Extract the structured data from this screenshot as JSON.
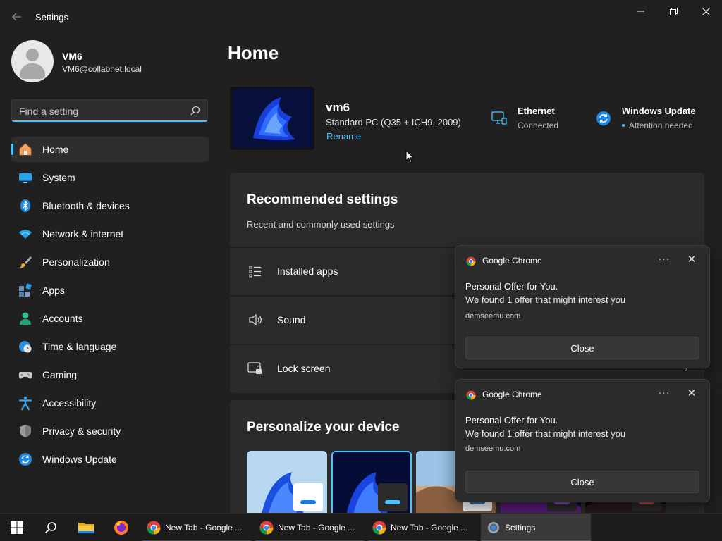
{
  "window": {
    "title": "Settings",
    "back_icon": "back-arrow-icon",
    "minimize_icon": "minimize-icon",
    "maximize_icon": "restore-icon",
    "close_icon": "close-icon"
  },
  "user": {
    "name": "VM6",
    "email": "VM6@collabnet.local",
    "avatar_icon": "user-avatar-icon"
  },
  "search": {
    "placeholder": "Find a setting",
    "icon": "search-icon"
  },
  "sidebar": {
    "active_color": "#4cc2ff",
    "items": [
      {
        "label": "Home",
        "icon": "home-icon",
        "active": true
      },
      {
        "label": "System",
        "icon": "system-icon"
      },
      {
        "label": "Bluetooth & devices",
        "icon": "bluetooth-icon"
      },
      {
        "label": "Network & internet",
        "icon": "wifi-icon"
      },
      {
        "label": "Personalization",
        "icon": "brush-icon"
      },
      {
        "label": "Apps",
        "icon": "apps-icon"
      },
      {
        "label": "Accounts",
        "icon": "accounts-icon"
      },
      {
        "label": "Time & language",
        "icon": "clock-globe-icon"
      },
      {
        "label": "Gaming",
        "icon": "gamepad-icon"
      },
      {
        "label": "Accessibility",
        "icon": "accessibility-icon"
      },
      {
        "label": "Privacy & security",
        "icon": "shield-icon"
      },
      {
        "label": "Windows Update",
        "icon": "update-icon"
      }
    ]
  },
  "main": {
    "title": "Home",
    "device": {
      "name": "vm6",
      "model": "Standard PC (Q35 + ICH9, 2009)",
      "rename_label": "Rename"
    },
    "status": {
      "ethernet": {
        "title": "Ethernet",
        "sub": "Connected",
        "icon": "ethernet-icon"
      },
      "update": {
        "title": "Windows Update",
        "sub": "Attention needed",
        "icon": "sync-icon"
      }
    },
    "recommended": {
      "title": "Recommended settings",
      "subtitle": "Recent and commonly used settings",
      "items": [
        {
          "label": "Installed apps",
          "icon": "list-icon"
        },
        {
          "label": "Sound",
          "icon": "speaker-icon"
        },
        {
          "label": "Lock screen",
          "icon": "lock-screen-icon"
        }
      ]
    },
    "personalize": {
      "title": "Personalize your device"
    }
  },
  "notifications": [
    {
      "app": "Google Chrome",
      "title": "Personal Offer for You.",
      "body": "We found 1 offer that might interest you",
      "source": "demseemu.com",
      "button": "Close",
      "more": "···",
      "close": "✕"
    },
    {
      "app": "Google Chrome",
      "title": "Personal Offer for You.",
      "body": "We found 1 offer that might interest you",
      "source": "demseemu.com",
      "button": "Close",
      "more": "···",
      "close": "✕"
    }
  ],
  "taskbar": {
    "pinned": [
      "windows-start-icon",
      "search-icon",
      "file-explorer-icon",
      "firefox-icon"
    ],
    "apps": [
      {
        "label": "New Tab - Google ...",
        "icon": "chrome-icon"
      },
      {
        "label": "New Tab - Google ...",
        "icon": "chrome-icon"
      },
      {
        "label": "New Tab - Google ...",
        "icon": "chrome-icon"
      },
      {
        "label": "Settings",
        "icon": "settings-gear-icon",
        "active": true
      }
    ]
  }
}
